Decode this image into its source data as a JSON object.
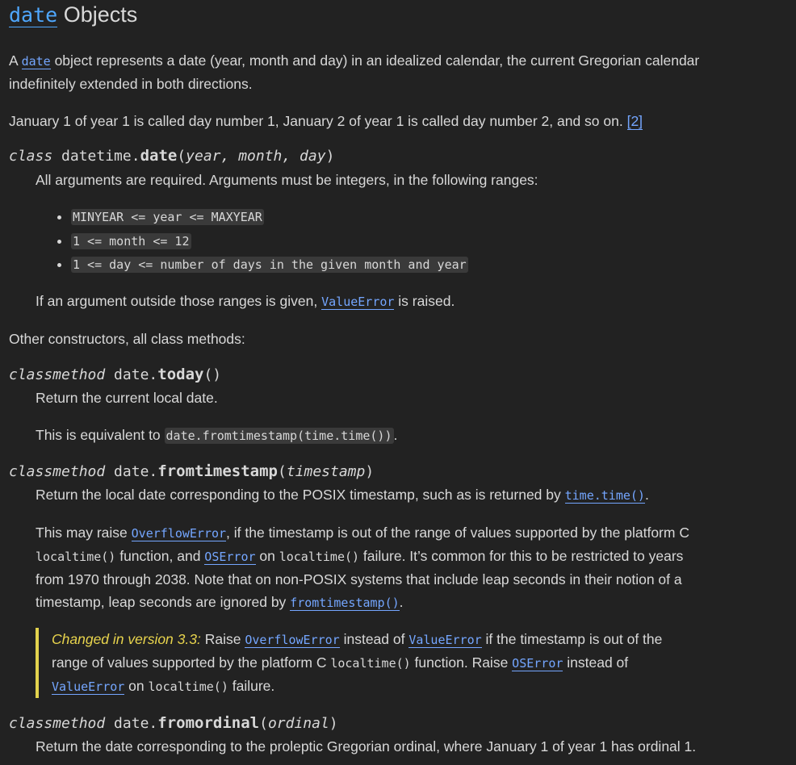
{
  "heading": {
    "code": "date",
    "text": " Objects"
  },
  "intro": {
    "p1_a": "A ",
    "p1_code": "date",
    "p1_b": " object represents a date (year, month and day) in an idealized calendar, the current Gregorian calendar indefinitely extended in both directions.",
    "p2_text": "January 1 of year 1 is called day number 1, January 2 of year 1 is called day number 2, and so on. ",
    "p2_ref": "[2]"
  },
  "ctor": {
    "kw": "class",
    "prefix": " datetime.",
    "name": "date",
    "open": "(",
    "params": "year, month, day",
    "close": ")",
    "desc": "All arguments are required. Arguments must be integers, in the following ranges:",
    "ranges": [
      "MINYEAR <= year <= MAXYEAR",
      "1 <= month <= 12",
      "1 <= day <= number of days in the given month and year"
    ],
    "err_a": "If an argument outside those ranges is given, ",
    "err_code": "ValueError",
    "err_b": " is raised."
  },
  "other_constructors": "Other constructors, all class methods:",
  "today": {
    "kw": "classmethod",
    "prefix": " date.",
    "name": "today",
    "parens": "()",
    "desc": "Return the current local date.",
    "eq_a": "This is equivalent to ",
    "eq_code": "date.fromtimestamp(time.time())",
    "eq_b": "."
  },
  "fromtimestamp": {
    "kw": "classmethod",
    "prefix": " date.",
    "name": "fromtimestamp",
    "open": "(",
    "param": "timestamp",
    "close": ")",
    "d1_a": "Return the local date corresponding to the POSIX timestamp, such as is returned by ",
    "d1_code": "time.time()",
    "d1_b": ".",
    "l1_a": "This may raise ",
    "l1_code": "OverflowError",
    "l1_b": ", if the timestamp is out of the range of values supported by the platform C",
    "l2_code1": "localtime()",
    "l2_a": " function, and ",
    "l2_code2": "OSError",
    "l2_b": " on ",
    "l2_code3": "localtime()",
    "l2_c": " failure. It’s common for this to be restricted to years",
    "l3": "from 1970 through 2038. Note that on non-POSIX systems that include leap seconds in their notion of a",
    "l4_a": "timestamp, leap seconds are ignored by ",
    "l4_code": "fromtimestamp()",
    "l4_b": ".",
    "note": {
      "version": "Changed in version 3.3:",
      "a": " Raise ",
      "c1": "OverflowError",
      "b": " instead of ",
      "c2": "ValueError",
      "c": " if the timestamp is out of the",
      "l2_a": "range of values supported by the platform C ",
      "l2_c3": "localtime()",
      "l2_b": " function. Raise ",
      "l2_c4": "OSError",
      "l2_c": " instead of",
      "l3_c5": "ValueError",
      "l3_a": " on ",
      "l3_c6": "localtime()",
      "l3_b": " failure."
    }
  },
  "fromordinal": {
    "kw": "classmethod",
    "prefix": " date.",
    "name": "fromordinal",
    "open": "(",
    "param": "ordinal",
    "close": ")",
    "desc": "Return the date corresponding to the proleptic Gregorian ordinal, where January 1 of year 1 has ordinal 1."
  }
}
